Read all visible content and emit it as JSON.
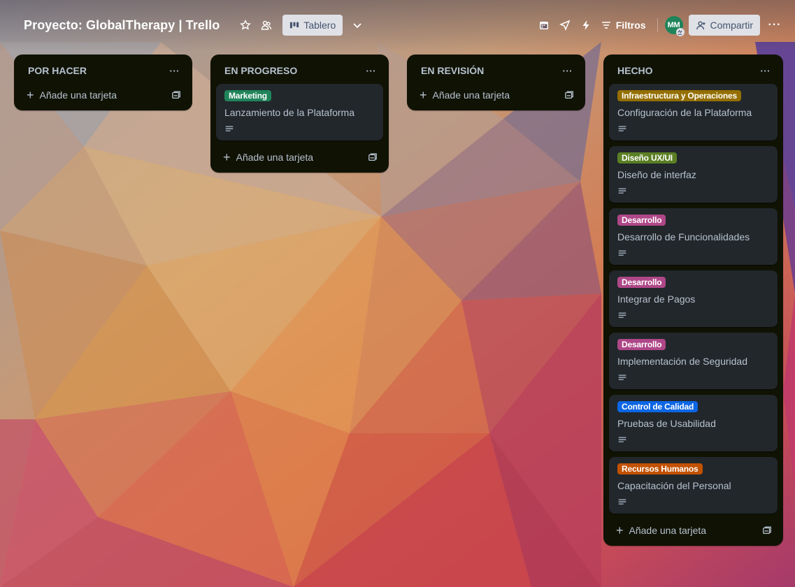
{
  "header": {
    "board_title": "Proyecto: GlobalTherapy | Trello",
    "view_label": "Tablero",
    "filter_label": "Filtros",
    "avatar_initials": "MM",
    "share_label": "Compartir",
    "more_label": "···"
  },
  "icons": {
    "star": "star-icon",
    "workspace": "workspace-visibility-icon",
    "board_view": "board-view-icon",
    "chevron": "chevron-down-icon",
    "calendar": "calendar-icon",
    "send": "send-icon",
    "automation": "lightning-icon",
    "filter": "filter-icon",
    "share": "share-user-icon",
    "description": "description-lines-icon",
    "template": "card-template-icon"
  },
  "colors": {
    "list_bg": "#101204",
    "card_bg": "#22272b",
    "text": "#b6c2cf",
    "label_marketing": "#1f845a",
    "label_infra": "#946f00",
    "label_ux": "#5b7f24",
    "label_dev": "#ae4787",
    "label_qa": "#0c66e4",
    "label_hr": "#c25100"
  },
  "lists": [
    {
      "title": "POR HACER",
      "menu": "···",
      "add_label": "Añade una tarjeta",
      "cards": []
    },
    {
      "title": "EN PROGRESO",
      "menu": "···",
      "add_label": "Añade una tarjeta",
      "cards": [
        {
          "label": "Marketing",
          "title": "Lanzamiento de la Plataforma"
        }
      ]
    },
    {
      "title": "EN REVISIÓN",
      "menu": "···",
      "add_label": "Añade una tarjeta",
      "cards": []
    },
    {
      "title": "HECHO",
      "menu": "···",
      "add_label": "Añade una tarjeta",
      "cards": [
        {
          "label": "Infraestructura y Operaciones",
          "title": "Configuración de la Plataforma"
        },
        {
          "label": "Diseño UX/UI",
          "title": "Diseño de interfaz"
        },
        {
          "label": "Desarrollo",
          "title": "Desarrollo de Funcionalidades"
        },
        {
          "label": "Desarrollo",
          "title": "Integrar de Pagos"
        },
        {
          "label": "Desarrollo",
          "title": "Implementación de Seguridad"
        },
        {
          "label": "Control de Calidad",
          "title": "Pruebas de Usabilidad"
        },
        {
          "label": "Recursos Humanos",
          "title": "Capacitación del Personal"
        }
      ]
    }
  ]
}
